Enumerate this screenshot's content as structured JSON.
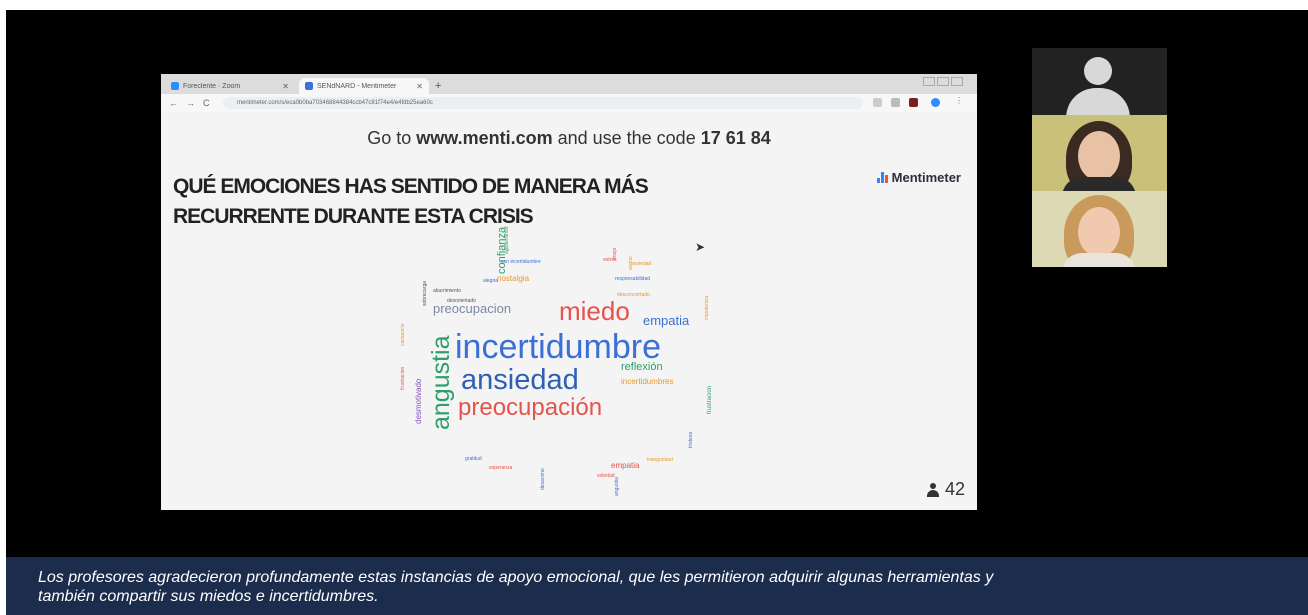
{
  "screen": {
    "tabs": [
      {
        "label": "Foreclente · Zoom",
        "color": "#2d8cff"
      },
      {
        "label": "SENdNARD - Mentimeter",
        "color": "#3b6fe0"
      }
    ],
    "url": "mentimeter.com/s/eca0b0ba703468844384ccb47c81f74e4/e4fdb25ea60c",
    "join_text": "Go to ",
    "join_site": "www.menti.com",
    "join_mid": " and use the code ",
    "join_code": "17 61 84",
    "brand": "Mentimeter",
    "question_line1": "QUÉ EMOCIONES HAS SENTIDO DE MANERA MÁS",
    "question_line2": "RECURRENTE DURANTE ESTA CRISIS",
    "participants": "42",
    "words": {
      "incertidumbre": "incertidumbre",
      "ansiedad": "ansiedad",
      "preocupacion_accent": "preocupación",
      "miedo": "miedo",
      "angustia": "angustia",
      "preocupacion": "preocupacion",
      "empatia": "empatia",
      "reflexion": "reflexión",
      "incertidumbres": "incertidumbres",
      "confianza": "confianza",
      "nostalgia": "nostalgia",
      "empatia_small": "empatia",
      "desmotivado": "desmotivado",
      "cansancio": "cansancio",
      "responsabilidad": "responsabilidad",
      "alegria": "alegria",
      "desconcertado": "desconcertado",
      "gratitud": "gratitud",
      "esperanza": "esperanza",
      "inseguridad": "inseguridad",
      "frustracion": "frustracion",
      "aburrimiento": "aburrimiento",
      "con_incertidumbre": "con incertidumbre",
      "estres": "estrés",
      "ansiedad_small": "ansiedad",
      "frustracion_v": "frustracion",
      "tristeza": "tristeza",
      "impotencia": "impotencia",
      "soledad": "soledad",
      "desanimo": "desanimo",
      "angustia_small": "angustia",
      "sobrecarga": "sobrecarga",
      "agotamiento": "agotamiento",
      "enojo": "enojo",
      "animo": "animo",
      "desorientado": "desorientado"
    }
  },
  "caption": {
    "line1": "Los profesores agradecieron profundamente estas instancias de apoyo emocional, que les permitieron adquirir algunas herramientas y",
    "line2": "también  compartir sus miedos e incertidumbres."
  },
  "colors": {
    "caption_bg": "#1c2c4c",
    "incertidumbre": "#3b6fd6",
    "ansiedad": "#2f5fb3",
    "preocupacion": "#e5534b",
    "miedo": "#e5534b",
    "angustia": "#2e9e6a"
  }
}
